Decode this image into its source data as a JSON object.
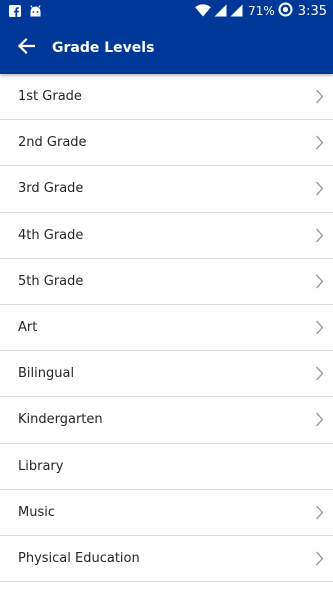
{
  "status_bar": {
    "battery_percent": "71%",
    "time": "3:35",
    "icons": [
      "facebook-icon",
      "android-icon",
      "wifi-icon",
      "signal-icon",
      "signal-icon",
      "battery-icon"
    ]
  },
  "app_bar": {
    "title": "Grade Levels",
    "back_icon": "arrow-left-icon",
    "color": "#00389a"
  },
  "items": [
    {
      "label": "1st Grade",
      "chevron": true
    },
    {
      "label": "2nd Grade",
      "chevron": true
    },
    {
      "label": "3rd Grade",
      "chevron": true
    },
    {
      "label": "4th Grade",
      "chevron": true
    },
    {
      "label": "5th Grade",
      "chevron": true
    },
    {
      "label": "Art",
      "chevron": true
    },
    {
      "label": "Bilingual",
      "chevron": true
    },
    {
      "label": "Kindergarten",
      "chevron": true
    },
    {
      "label": "Library",
      "chevron": false
    },
    {
      "label": "Music",
      "chevron": true
    },
    {
      "label": "Physical Education",
      "chevron": true
    }
  ]
}
